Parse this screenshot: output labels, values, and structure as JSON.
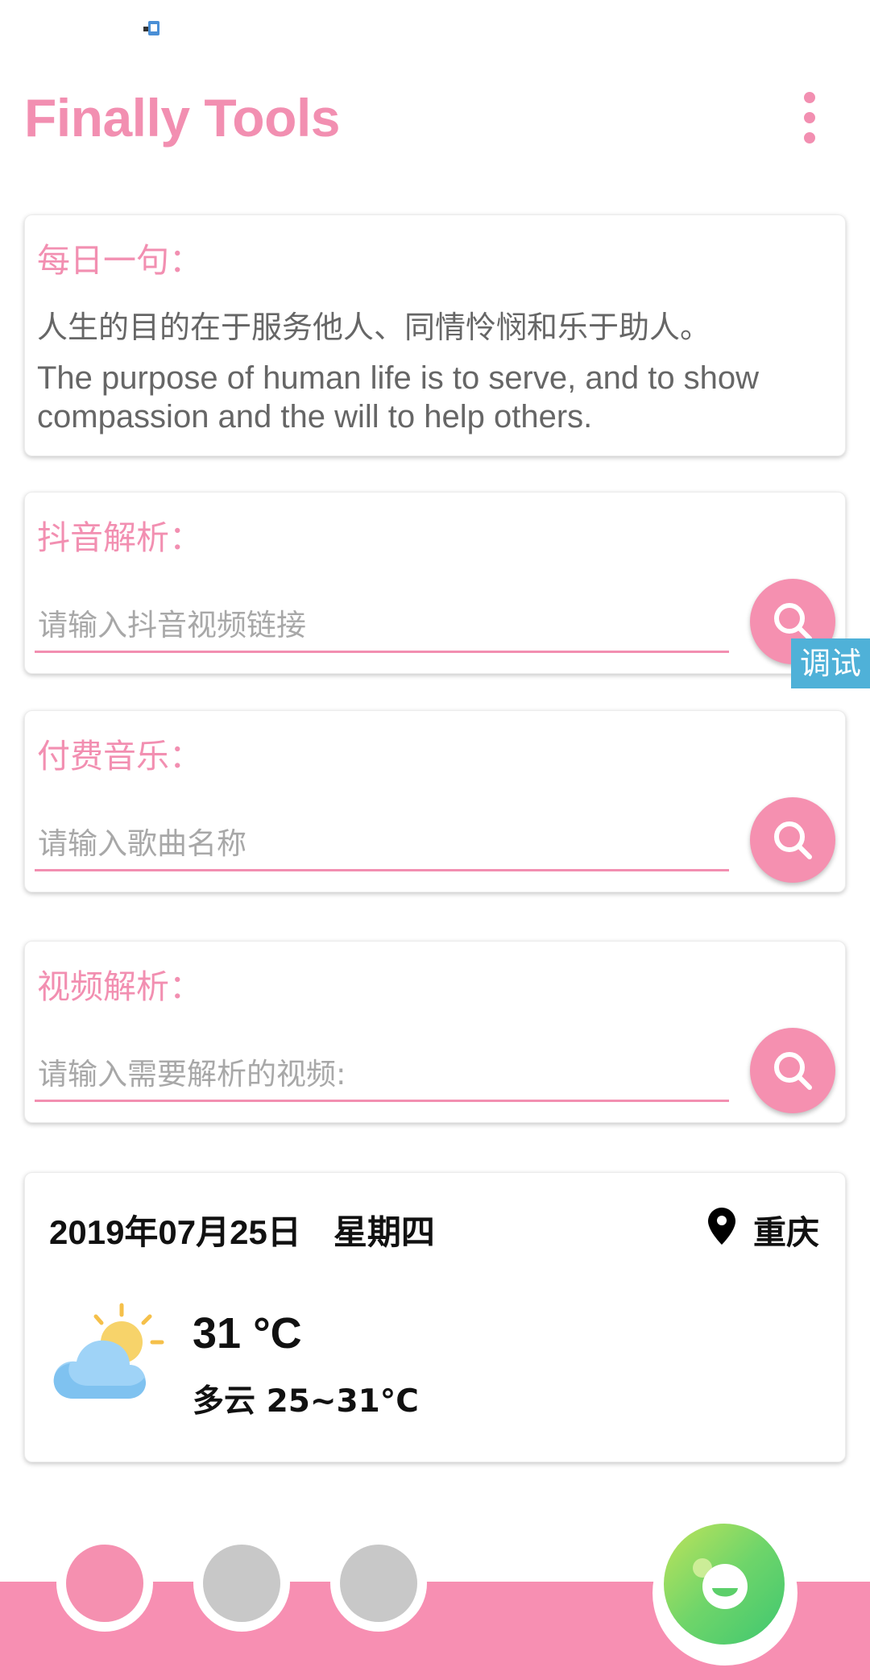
{
  "app": {
    "title": "Finally Tools"
  },
  "daily_quote": {
    "label": "每日一句：",
    "chinese": "人生的目的在于服务他人、同情怜悯和乐于助人。",
    "english": "The purpose of human life is to serve, and to show compassion and the will to help others."
  },
  "douyin": {
    "label": "抖音解析：",
    "placeholder": "请输入抖音视频链接"
  },
  "debug_tag": "调试",
  "music": {
    "label": "付费音乐：",
    "placeholder": "请输入歌曲名称"
  },
  "video": {
    "label": "视频解析：",
    "placeholder": "请输入需要解析的视频:"
  },
  "weather": {
    "date": "2019年07月25日",
    "weekday": "星期四",
    "city": "重庆",
    "temperature": "31 °C",
    "description": "多云 25~31°C",
    "icon": "partly-cloudy-icon"
  },
  "bottom_nav": {
    "dots": [
      {
        "state": "active",
        "color": "#f590b0"
      },
      {
        "state": "inactive",
        "color": "#c8c8c8"
      },
      {
        "state": "inactive",
        "color": "#c8c8c8"
      }
    ],
    "fab_icon": "smiley-icon"
  },
  "colors": {
    "accent": "#f28fb1",
    "bottom_bar": "#f78fb2",
    "debug_tag": "#4fb1d8",
    "fab_green": "#5ccf6a"
  }
}
